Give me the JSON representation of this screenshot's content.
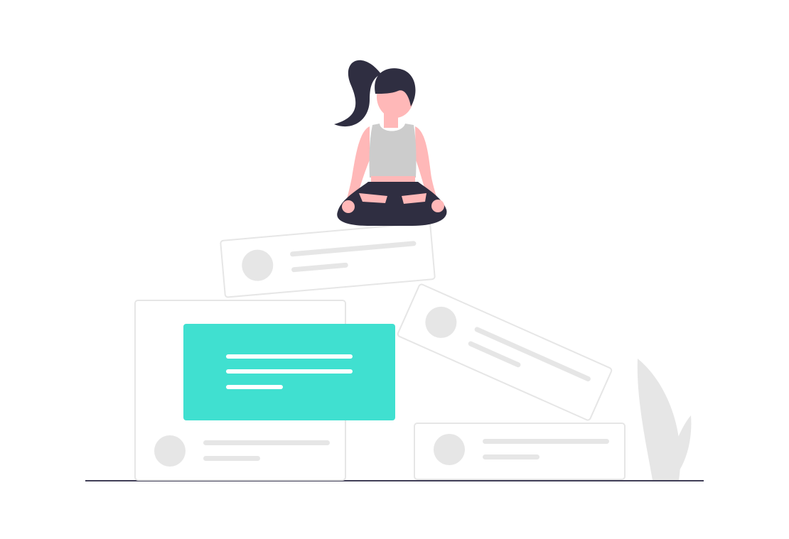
{
  "illustration": {
    "subject": "meditating-woman-on-stacked-cards",
    "colors": {
      "background": "#ffffff",
      "card_border": "#e6e6e6",
      "placeholder": "#e6e6e6",
      "highlight_card": "#40e0d0",
      "highlight_text_line": "#ffffff",
      "ground_line": "#3f3d56",
      "skin": "#ffb8b8",
      "hair": "#2f2e41",
      "top": "#cccccc",
      "pants": "#2f2e41",
      "plant": "#e6e6e6"
    },
    "cards": [
      {
        "role": "top-tilted-card",
        "highlighted": false,
        "avatar": true,
        "text_lines": 2
      },
      {
        "role": "right-tilted-card",
        "highlighted": false,
        "avatar": true,
        "text_lines": 2
      },
      {
        "role": "large-left-card",
        "highlighted": false,
        "avatar": true,
        "text_lines": 2
      },
      {
        "role": "highlighted-card",
        "highlighted": true,
        "avatar": false,
        "text_lines": 3
      },
      {
        "role": "bottom-right-card",
        "highlighted": false,
        "avatar": true,
        "text_lines": 2
      }
    ]
  }
}
